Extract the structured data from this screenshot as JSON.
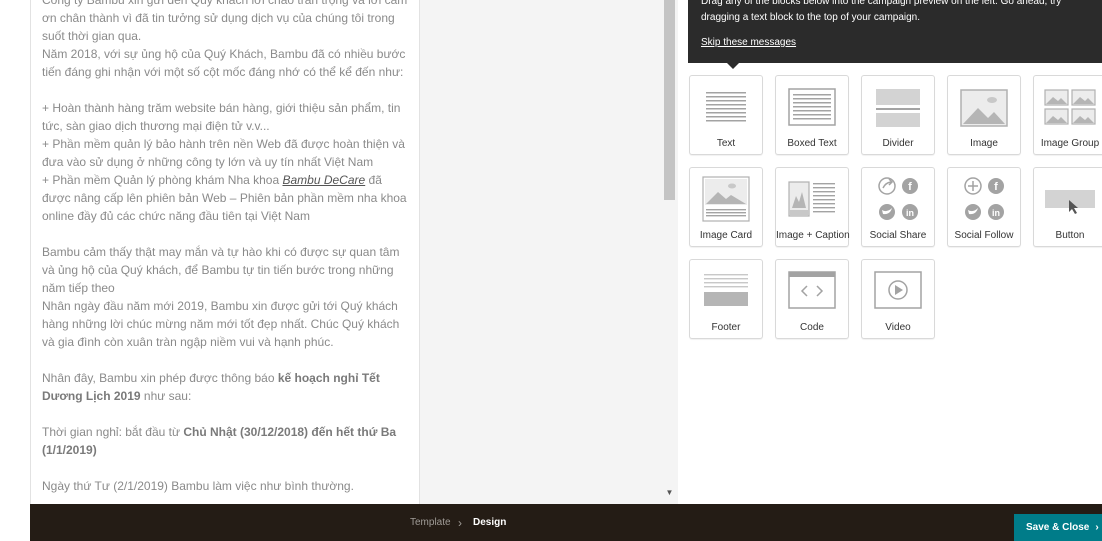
{
  "preview": {
    "paragraphs": [
      "Công ty Bambu xin gửi đến Quý khách lời chào trân trọng và lời cảm ơn chân thành vì đã tin tưởng sử dụng dịch vụ của chúng tôi trong suốt thời gian qua.",
      "Năm 2018, với sự ủng hộ của Quý Khách, Bambu đã có nhiều bước tiến đáng ghi nhận với một số cột mốc đáng nhớ có thể kể đến như:",
      "",
      "+ Hoàn thành hàng trăm website bán hàng, giới thiệu sản phẩm, tin tức, sàn giao dịch thương mại điện tử v.v...",
      "+ Phần mềm quản lý bảo hành trên nền Web đã được hoàn thiện và đưa vào sử dụng ở những công ty lớn và uy tín nhất Việt Nam"
    ],
    "line_decare_prefix": "+ Phần mềm Quản lý phòng khám Nha khoa ",
    "line_decare_link": "Bambu DeCare",
    "line_decare_suffix": " đã được nâng cấp lên phiên bản Web – Phiên bản phần mềm nha khoa online đầy đủ các chức năng đầu tiên tại Việt Nam",
    "para_lucky": "Bambu cảm thấy thật may mắn và tự hào khi có được sự quan tâm và ủng hộ của Quý khách, để Bambu tự tin tiến bước trong những năm tiếp theo",
    "para_newyear": "Nhân ngày đầu năm mới 2019, Bambu xin được gửi tới Quý khách hàng những lời chúc mừng năm mới tốt đẹp nhất. Chúc Quý khách và gia đình còn xuân tràn ngập niềm vui và hạnh phúc.",
    "notice_prefix": "Nhân đây, Bambu xin phép được thông báo ",
    "notice_bold": "kế hoạch nghỉ Tết Dương Lịch 2019",
    "notice_suffix": " như sau:",
    "time_prefix": "Thời gian nghỉ: bắt đầu từ ",
    "time_bold": "Chủ Nhật (30/12/2018) đến hết thứ Ba (1/1/2019)",
    "resume": "Ngày thứ Tư (2/1/2019) Bambu làm việc như bình thường."
  },
  "tip": {
    "text": "Drag any of the blocks below into the campaign preview on the left. Go ahead, try dragging a text block to the top of your campaign.",
    "skip_label": "Skip these messages"
  },
  "blocks": [
    {
      "label": "Text",
      "icon": "text-block-icon"
    },
    {
      "label": "Boxed Text",
      "icon": "boxed-text-block-icon"
    },
    {
      "label": "Divider",
      "icon": "divider-block-icon"
    },
    {
      "label": "Image",
      "icon": "image-block-icon"
    },
    {
      "label": "Image Group",
      "icon": "image-group-block-icon"
    },
    {
      "label": "Image Card",
      "icon": "image-card-block-icon"
    },
    {
      "label": "Image + Caption",
      "icon": "image-caption-block-icon"
    },
    {
      "label": "Social Share",
      "icon": "social-share-block-icon"
    },
    {
      "label": "Social Follow",
      "icon": "social-follow-block-icon"
    },
    {
      "label": "Button",
      "icon": "button-block-icon"
    },
    {
      "label": "Footer",
      "icon": "footer-block-icon"
    },
    {
      "label": "Code",
      "icon": "code-block-icon"
    },
    {
      "label": "Video",
      "icon": "video-block-icon"
    }
  ],
  "bottombar": {
    "crumb_template": "Template",
    "crumb_separator": "›",
    "crumb_design": "Design",
    "save_label": "Save & Close",
    "save_arrow": "›"
  },
  "colors": {
    "tip_background": "#2b2b2b",
    "bottombar_background": "#241c15",
    "save_button": "#007c89"
  }
}
